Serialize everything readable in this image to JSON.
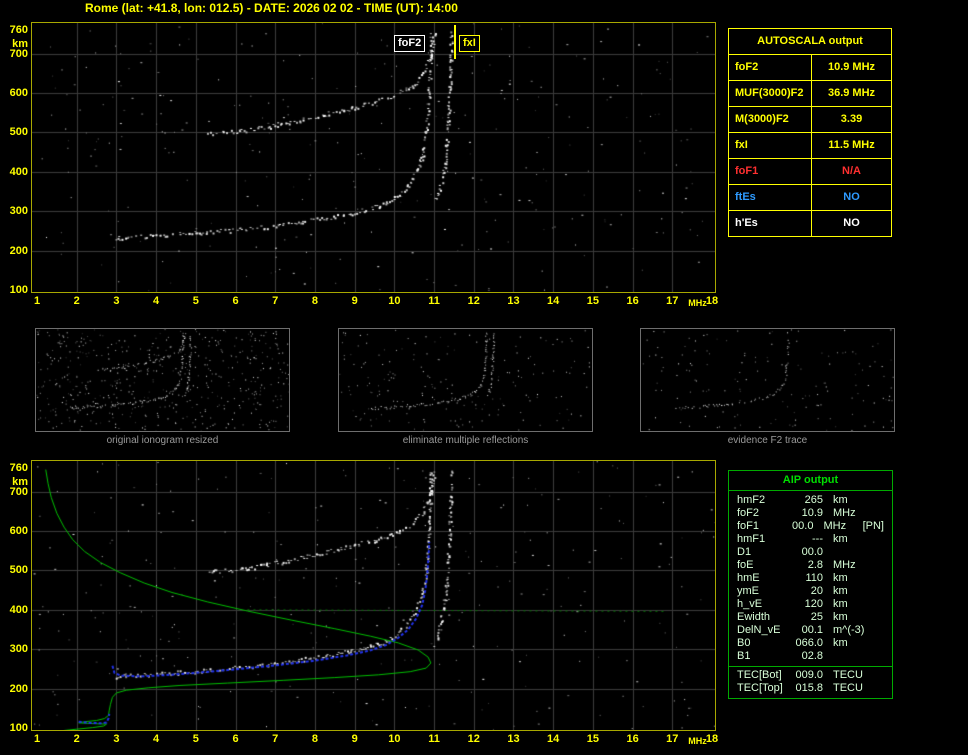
{
  "header": {
    "station": "Rome",
    "lat": "+41.8",
    "lon": "012.5",
    "date": "2026 02 02",
    "time_ut": "14:00",
    "full": "Rome (lat: +41.8, lon: 012.5) - DATE: 2026 02 02 - TIME (UT): 14:00"
  },
  "autoscala": {
    "header": "AUTOSCALA output",
    "rows": [
      {
        "label": "foF2",
        "value": "10.9 MHz",
        "color": "#ffff00"
      },
      {
        "label": "MUF(3000)F2",
        "value": "36.9 MHz",
        "color": "#ffff00"
      },
      {
        "label": "M(3000)F2",
        "value": "3.39",
        "color": "#ffff00"
      },
      {
        "label": "fxI",
        "value": "11.5 MHz",
        "color": "#ffff00"
      },
      {
        "label": "foF1",
        "value": "N/A",
        "color": "#ff3030"
      },
      {
        "label": "ftEs",
        "value": "NO",
        "color": "#2e9bff"
      },
      {
        "label": "h'Es",
        "value": "NO",
        "color": "#ffffff"
      }
    ]
  },
  "thumbnails": [
    {
      "caption": "original ionogram resized"
    },
    {
      "caption": "eliminate multiple reflections"
    },
    {
      "caption": "evidence F2 trace"
    }
  ],
  "aip": {
    "header": "AIP output",
    "rows": [
      {
        "label": "hmF2",
        "value": "265",
        "unit": "km",
        "note": ""
      },
      {
        "label": "foF2",
        "value": "10.9",
        "unit": "MHz",
        "note": ""
      },
      {
        "label": "foF1",
        "value": "00.0",
        "unit": "MHz",
        "note": "[PN]"
      },
      {
        "label": "hmF1",
        "value": "---",
        "unit": "km",
        "note": ""
      },
      {
        "label": "D1",
        "value": "00.0",
        "unit": "",
        "note": ""
      },
      {
        "label": "foE",
        "value": "2.8",
        "unit": "MHz",
        "note": ""
      },
      {
        "label": "hmE",
        "value": "110",
        "unit": "km",
        "note": ""
      },
      {
        "label": "ymE",
        "value": "20",
        "unit": "km",
        "note": ""
      },
      {
        "label": "h_vE",
        "value": "120",
        "unit": "km",
        "note": ""
      },
      {
        "label": "Ewidth",
        "value": "25",
        "unit": "km",
        "note": ""
      },
      {
        "label": "DelN_vE",
        "value": "00.1",
        "unit": "m^(-3)",
        "note": ""
      },
      {
        "label": "B0",
        "value": "066.0",
        "unit": "km",
        "note": ""
      },
      {
        "label": "B1",
        "value": "02.8",
        "unit": "",
        "note": ""
      }
    ],
    "tec_rows": [
      {
        "label": "TEC[Bot]",
        "value": "009.0",
        "unit": "TECU",
        "note": ""
      },
      {
        "label": "TEC[Top]",
        "value": "015.8",
        "unit": "TECU",
        "note": ""
      }
    ]
  },
  "colors": {
    "accent_yellow": "#ffff00",
    "accent_green": "#00c000",
    "accent_blue": "#2233ee",
    "panel_border": "#a8a800",
    "grid": "#3c3c3c"
  },
  "chart_data": {
    "type": "scatter",
    "title": "Ionogram (virtual height vs sounding frequency)",
    "xlabel": "MHz",
    "ylabel": "km",
    "x_unit": "MHz",
    "y_unit": "km",
    "x_range": [
      1,
      18
    ],
    "y_range": [
      100,
      760
    ],
    "x_ticks": [
      1,
      2,
      3,
      4,
      5,
      6,
      7,
      8,
      9,
      10,
      11,
      12,
      13,
      14,
      15,
      16,
      17,
      18
    ],
    "y_ticks": [
      760,
      700,
      600,
      500,
      400,
      300,
      200,
      100
    ],
    "markers": {
      "foF2": {
        "text": "foF2",
        "mhz": 10.9
      },
      "fxI": {
        "text": "fxI",
        "mhz": 11.5
      }
    },
    "traces": {
      "f2_trace": [
        [
          2.95,
          231
        ],
        [
          3.2,
          234
        ],
        [
          4,
          238
        ],
        [
          5,
          245
        ],
        [
          6,
          253
        ],
        [
          7,
          263
        ],
        [
          7.6,
          273
        ],
        [
          8.3,
          284
        ],
        [
          8.9,
          296
        ],
        [
          9.4,
          308
        ],
        [
          9.8,
          322
        ],
        [
          10.1,
          342
        ],
        [
          10.35,
          368
        ],
        [
          10.55,
          400
        ],
        [
          10.7,
          445
        ],
        [
          10.8,
          505
        ],
        [
          10.85,
          570
        ],
        [
          10.88,
          640
        ],
        [
          10.9,
          700
        ],
        [
          10.91,
          752
        ]
      ],
      "f2_xmode": [
        [
          11.05,
          330
        ],
        [
          11.15,
          365
        ],
        [
          11.24,
          410
        ],
        [
          11.3,
          465
        ],
        [
          11.34,
          525
        ],
        [
          11.37,
          590
        ],
        [
          11.4,
          660
        ],
        [
          11.42,
          752
        ]
      ],
      "second_reflection": [
        [
          5.3,
          497
        ],
        [
          6.1,
          504
        ],
        [
          6.8,
          515
        ],
        [
          7.6,
          532
        ],
        [
          8.3,
          547
        ],
        [
          8.9,
          562
        ],
        [
          9.5,
          578
        ],
        [
          9.9,
          592
        ],
        [
          10.4,
          615
        ],
        [
          10.7,
          648
        ],
        [
          10.9,
          695
        ],
        [
          11.0,
          752
        ]
      ]
    },
    "curves": {
      "green_dotted": {
        "color": "#007a00",
        "width": 1,
        "dash": [
          2,
          4
        ],
        "points": [
          [
            6.3,
            400
          ],
          [
            16.8,
            396
          ]
        ]
      },
      "green_profile": {
        "color": "#00c000",
        "width": 1,
        "points": [
          [
            1.22,
            756
          ],
          [
            1.28,
            720
          ],
          [
            1.36,
            685
          ],
          [
            1.5,
            645
          ],
          [
            1.68,
            610
          ],
          [
            1.9,
            578
          ],
          [
            2.2,
            548
          ],
          [
            2.6,
            520
          ],
          [
            3.1,
            494
          ],
          [
            3.7,
            468
          ],
          [
            4.4,
            444
          ],
          [
            5.3,
            420
          ],
          [
            6.3,
            397
          ],
          [
            7.4,
            374
          ],
          [
            8.5,
            352
          ],
          [
            9.4,
            333
          ],
          [
            10.1,
            316
          ],
          [
            10.6,
            298
          ],
          [
            10.85,
            280
          ],
          [
            10.92,
            265
          ],
          [
            10.8,
            252
          ],
          [
            10.4,
            243
          ],
          [
            9.6,
            235
          ],
          [
            8.5,
            228
          ],
          [
            7.2,
            221
          ],
          [
            5.8,
            214
          ],
          [
            4.6,
            208
          ],
          [
            3.8,
            202
          ],
          [
            3.25,
            196
          ],
          [
            3.0,
            189
          ],
          [
            2.9,
            178
          ],
          [
            2.85,
            160
          ],
          [
            2.82,
            145
          ],
          [
            2.8,
            132
          ],
          [
            2.7,
            124
          ],
          [
            2.5,
            119
          ],
          [
            2.2,
            116
          ],
          [
            2.05,
            113
          ],
          [
            2.45,
            111
          ],
          [
            2.75,
            110
          ],
          [
            2.68,
            105
          ],
          [
            2.4,
            101
          ],
          [
            2.0,
            97
          ],
          [
            1.6,
            93
          ]
        ]
      },
      "blue_e": {
        "color": "#2233ee",
        "width": 2,
        "dash": [
          3,
          2
        ],
        "points": [
          [
            2.05,
            116
          ],
          [
            2.35,
            113
          ],
          [
            2.6,
            112
          ],
          [
            2.75,
            114
          ],
          [
            2.8,
            124
          ],
          [
            2.82,
            136
          ]
        ]
      },
      "blue_trace": {
        "color": "#2233ee",
        "width": 2,
        "dash": [
          3,
          2
        ],
        "points": [
          [
            2.9,
            258
          ],
          [
            2.95,
            240
          ],
          [
            3.1,
            233
          ],
          [
            3.6,
            231
          ],
          [
            4.2,
            234
          ],
          [
            5,
            240
          ],
          [
            6,
            249
          ],
          [
            7,
            259
          ],
          [
            8,
            271
          ],
          [
            8.8,
            284
          ],
          [
            9.4,
            297
          ],
          [
            9.8,
            311
          ],
          [
            10.1,
            329
          ],
          [
            10.35,
            350
          ],
          [
            10.55,
            378
          ],
          [
            10.7,
            412
          ],
          [
            10.78,
            450
          ],
          [
            10.83,
            492
          ],
          [
            10.86,
            535
          ],
          [
            10.88,
            572
          ]
        ]
      }
    },
    "panels": {
      "main": {
        "traces": [
          "f2_trace",
          "f2_xmode",
          "second_reflection"
        ],
        "noise": 300,
        "keep": 0.85,
        "curves": []
      },
      "bottom": {
        "traces": [
          "f2_trace",
          "f2_xmode",
          "second_reflection"
        ],
        "noise": 300,
        "keep": 0.85,
        "curves": [
          "green_dotted",
          "green_profile",
          "blue_e",
          "blue_trace"
        ]
      },
      "thumb1": {
        "traces": [
          "f2_trace",
          "f2_xmode",
          "second_reflection"
        ],
        "noise": 520,
        "keep": 0.8,
        "curves": []
      },
      "thumb2": {
        "traces": [
          "f2_trace",
          "f2_xmode"
        ],
        "noise": 190,
        "keep": 0.8,
        "curves": []
      },
      "thumb3": {
        "traces": [
          "f2_trace"
        ],
        "noise": 150,
        "keep": 0.55,
        "curves": []
      }
    }
  }
}
